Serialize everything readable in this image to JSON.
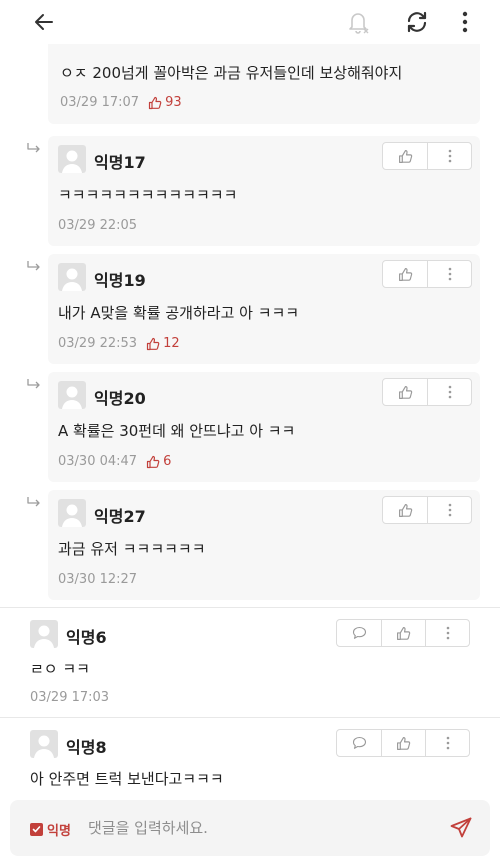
{
  "header": {
    "back_icon": "arrow-left-icon",
    "bell_icon": "bell-off-icon",
    "refresh_icon": "refresh-icon",
    "more_icon": "more-vertical-icon"
  },
  "top_comment": {
    "text": "ㅇㅈ 200넘게 꼴아박은 과금 유저들인데 보상해줘야지",
    "time": "03/29 17:07",
    "likes": "93"
  },
  "replies": [
    {
      "author": "익명17",
      "text": "ㅋㅋㅋㅋㅋㅋㅋㅋㅋㅋㅋㅋㅋ",
      "time": "03/29 22:05",
      "likes": ""
    },
    {
      "author": "익명19",
      "text": "내가 A맞을 확률 공개하라고 아 ㅋㅋㅋ",
      "time": "03/29 22:53",
      "likes": "12"
    },
    {
      "author": "익명20",
      "text": "A 확률은 30펀데 왜 안뜨냐고 아 ㅋㅋ",
      "time": "03/30 04:47",
      "likes": "6"
    },
    {
      "author": "익명27",
      "text": "과금 유저 ㅋㅋㅋㅋㅋㅋ",
      "time": "03/30 12:27",
      "likes": ""
    }
  ],
  "comments": [
    {
      "author": "익명6",
      "text": "ㄹㅇ ㅋㅋ",
      "time": "03/29 17:03"
    },
    {
      "author": "익명8",
      "text": "아 안주면 트럭 보낸다고ㅋㅋㅋ",
      "time": ""
    }
  ],
  "input_bar": {
    "anonymous_label": "익명",
    "anonymous_checked": true,
    "placeholder": "댓글을 입력하세요.",
    "send_icon": "send-icon"
  },
  "colors": {
    "accent": "#c2403b",
    "card_bg": "#f7f7f7",
    "meta_text": "#9a9a9a"
  }
}
